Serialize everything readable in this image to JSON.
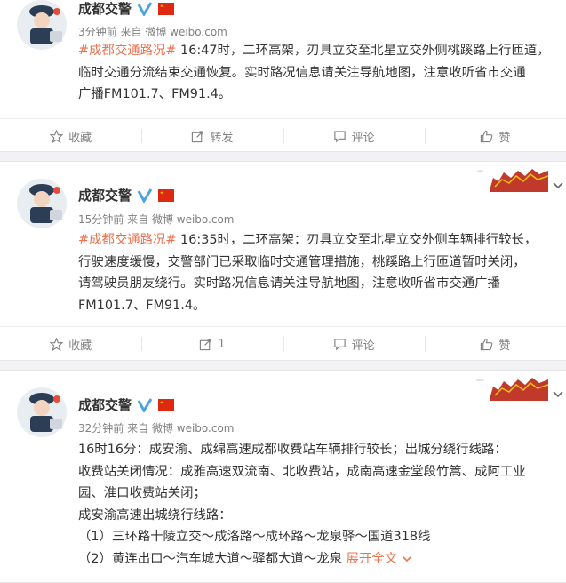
{
  "feed": {
    "posts": [
      {
        "author": "成都交警",
        "time": "3分钟前",
        "source_prefix": "来自",
        "source": "微博 weibo.com",
        "tag": "#成都交通路况#",
        "text": " 16:47时，二环高架，刃具立交至北星立交外侧桃蹊路上行匝道，\n临时交通分流结束交通恢复。实时路况信息请关注导航地图，注意收听省市交通\n广播FM101.7、FM91.4。",
        "actions": {
          "collect": "收藏",
          "repost": "转发",
          "comment": "评论",
          "like": "赞"
        }
      },
      {
        "author": "成都交警",
        "time": "15分钟前",
        "source_prefix": "来自",
        "source": "微博 weibo.com",
        "tag": "#成都交通路况#",
        "text": " 16:35时，二环高架：刃具立交至北星立交外侧车辆排行较长，\n行驶速度缓慢，交警部门已采取临时交通管理措施，桃蹊路上行匝道暂时关闭，\n请驾驶员朋友绕行。实时路况信息请关注导航地图，注意收听省市交通广播\nFM101.7、FM91.4。",
        "actions": {
          "collect": "收藏",
          "repost": "1",
          "comment": "评论",
          "like": "赞"
        }
      },
      {
        "author": "成都交警",
        "time": "32分钟前",
        "source_prefix": "来自",
        "source": "微博 weibo.com",
        "text": "16时16分：成安渝、成绵高速成都收费站车辆排行较长；出城分绕行线路：\n收费站关闭情况：成雅高速双流南、北收费站，成南高速金堂段竹篙、成阿工业\n园、淮口收费站关闭；\n成安渝高速出城绕行线路：\n（1）三环路十陵立交～成洛路～成环路～龙泉驿～国道318线\n（2）黄连出口～汽车城大道～驿都大道～龙泉 ",
        "more": "展开全文",
        "more_icon": "chevron-down-icon"
      }
    ]
  },
  "colors": {
    "link": "#eb7350",
    "meta": "#808080",
    "verified": "#ffc600"
  }
}
